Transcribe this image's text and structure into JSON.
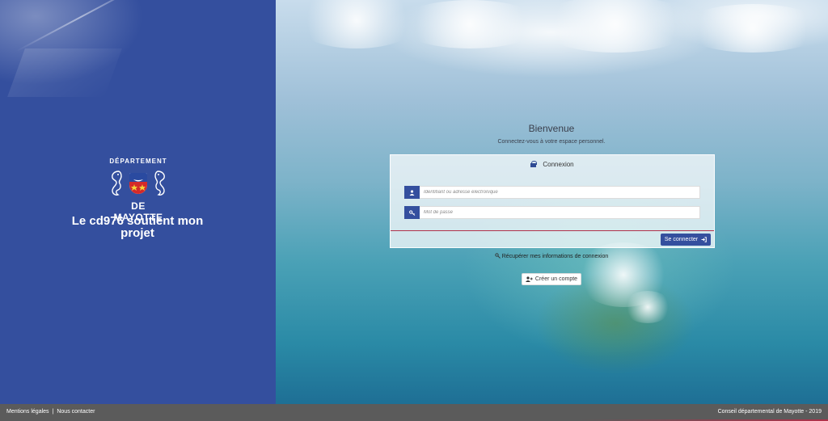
{
  "brand": {
    "logo_top": "DÉPARTEMENT",
    "logo_bottom": "DE MAYOTTE",
    "tagline": "Le cd976 soutient mon projet"
  },
  "login": {
    "welcome": "Bienvenue",
    "subtitle": "Connectez-vous à votre espace personnel.",
    "panel_title": "Connexion",
    "username_placeholder": "Identifiant ou adresse électronique",
    "password_placeholder": "Mot de passe",
    "submit_label": "Se connecter",
    "recover_label": "Récupérer mes informations de connexion",
    "create_label": "Créer un compte"
  },
  "footer": {
    "legal": "Mentions légales",
    "separator": "|",
    "contact": "Nous contacter",
    "copyright": "Conseil départemental de Mayotte - 2019"
  },
  "colors": {
    "primary": "#344f9e",
    "accent_red": "#b0314a",
    "footer_bg": "#5b5b5b"
  },
  "icons": {
    "lock": "lock-icon",
    "user": "user-icon",
    "key": "key-icon",
    "sign_in": "sign-in-icon",
    "recover": "key-search-icon",
    "add_user": "user-plus-icon"
  }
}
